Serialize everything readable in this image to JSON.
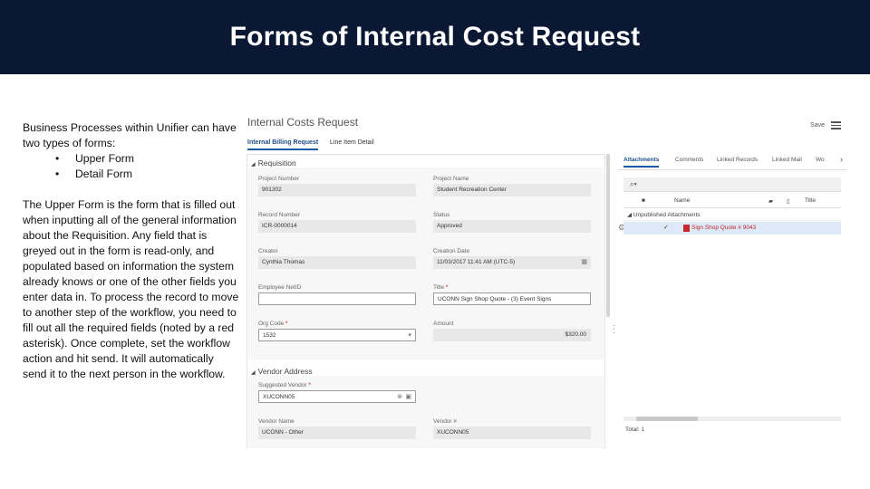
{
  "slide": {
    "title": "Forms of Internal Cost Request",
    "intro": "Business Processes within Unifier can have two types of forms:",
    "bullets": [
      "Upper Form",
      "Detail Form"
    ],
    "body": "The Upper Form is the form that is filled out when inputting all of the general information about the Requisition. Any field that is greyed out in the form is read-only, and populated based on information the system already knows or one of the other fields you enter data in. To process the record to move to another step of the workflow, you need to fill out all the required fields (noted by a red asterisk). Once complete, set the workflow action and hit send. It will automatically send it to the next person in the workflow.",
    "banner_color": "#0b1833"
  },
  "app": {
    "title": "Internal Costs Request",
    "save_label": "Save",
    "tabs": [
      "Internal Billing Request",
      "Line Item Detail"
    ],
    "requisition": {
      "header": "Requisition",
      "fields": {
        "project_number": {
          "label": "Project Number",
          "value": "901302"
        },
        "project_name": {
          "label": "Project Name",
          "value": "Student Recreation Center"
        },
        "record_number": {
          "label": "Record Number",
          "value": "ICR-0000014"
        },
        "status": {
          "label": "Status",
          "value": "Approved"
        },
        "creator": {
          "label": "Creator",
          "value": "Cynthia Thomas"
        },
        "creation_date": {
          "label": "Creation Date",
          "value": "11/03/2017 11:41 AM  (UTC-5)"
        },
        "employee_netid": {
          "label": "Employee NetID",
          "value": ""
        },
        "title": {
          "label": "Title",
          "value": "UCONN Sign Shop Quote - (3) Event Signs"
        },
        "org_code": {
          "label": "Org Code",
          "value": "1532"
        },
        "amount": {
          "label": "Amount",
          "value": "$320.00"
        }
      }
    },
    "vendor": {
      "header": "Vendor Address",
      "fields": {
        "suggested_vendor": {
          "label": "Suggested Vendor",
          "value": "XUCONN05"
        },
        "vendor_name": {
          "label": "Vendor Name",
          "value": "UCONN - Other"
        },
        "vendor_number": {
          "label": "Vendor #",
          "value": "XUCONN05"
        }
      }
    },
    "right_tabs": [
      "Attachments",
      "Comments",
      "Linked Records",
      "Linked Mail",
      "Wo"
    ],
    "columns": {
      "name": "Name",
      "title": "Title"
    },
    "group_label": "Unpublished Attachments",
    "attachment": "Sign Shop Quote # 9043",
    "total": "Total: 1",
    "accent_color": "#1d5aa6"
  }
}
